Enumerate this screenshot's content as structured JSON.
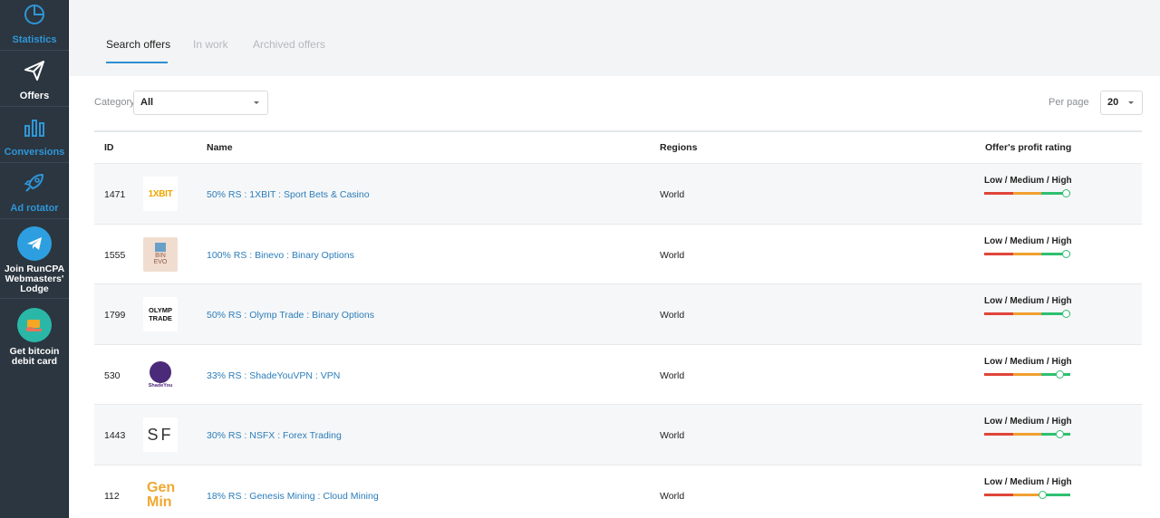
{
  "sidebar": {
    "items": [
      {
        "label": "Statistics",
        "icon": "pie-chart-icon"
      },
      {
        "label": "Offers",
        "icon": "paper-plane-icon"
      },
      {
        "label": "Conversions",
        "icon": "bar-chart-icon"
      },
      {
        "label": "Ad rotator",
        "icon": "rocket-icon"
      }
    ],
    "promos": [
      {
        "label": "Join RunCPA Webmasters' Lodge",
        "icon": "telegram-icon"
      },
      {
        "label": "Get bitcoin debit card",
        "icon": "card-in-hand-icon"
      }
    ]
  },
  "tabs": [
    {
      "label": "Search offers",
      "active": true
    },
    {
      "label": "In work",
      "active": false
    },
    {
      "label": "Archived offers",
      "active": false
    }
  ],
  "filters": {
    "category_label": "Category",
    "category_value": "All",
    "per_page_label": "Per page",
    "per_page_value": "20"
  },
  "table": {
    "columns": {
      "id": "ID",
      "name": "Name",
      "regions": "Regions",
      "rating": "Offer's profit rating"
    },
    "rating_label": "Low / Medium / High",
    "rows": [
      {
        "id": "1471",
        "name": "50% RS : 1XBIT : Sport Bets & Casino",
        "region": "World",
        "logo_text": "1XBIT",
        "rating": 1.0
      },
      {
        "id": "1555",
        "name": "100% RS : Binevo : Binary Options",
        "region": "World",
        "logo_text": "BIN EVO",
        "rating": 1.0
      },
      {
        "id": "1799",
        "name": "50% RS : Olymp Trade : Binary Options",
        "region": "World",
        "logo_text": "OLYMP TRADE",
        "rating": 0.95
      },
      {
        "id": "530",
        "name": "33% RS : ShadeYouVPN : VPN",
        "region": "World",
        "logo_text": "ShadeYou",
        "rating": 0.88
      },
      {
        "id": "1443",
        "name": "30% RS : NSFX : Forex Trading",
        "region": "World",
        "logo_text": "SF",
        "rating": 0.88
      },
      {
        "id": "112",
        "name": "18% RS : Genesis Mining : Cloud Mining",
        "region": "World",
        "logo_text": "Gen Min",
        "rating": 0.68
      }
    ]
  },
  "colors": {
    "sidebar_bg": "#2b3640",
    "sidebar_accent": "#2f96d8",
    "link": "#2b7dba",
    "tab_underline": "#2f8fd0",
    "rating_low": "#e0453a",
    "rating_medium": "#f0a030",
    "rating_high": "#2fbf71"
  }
}
